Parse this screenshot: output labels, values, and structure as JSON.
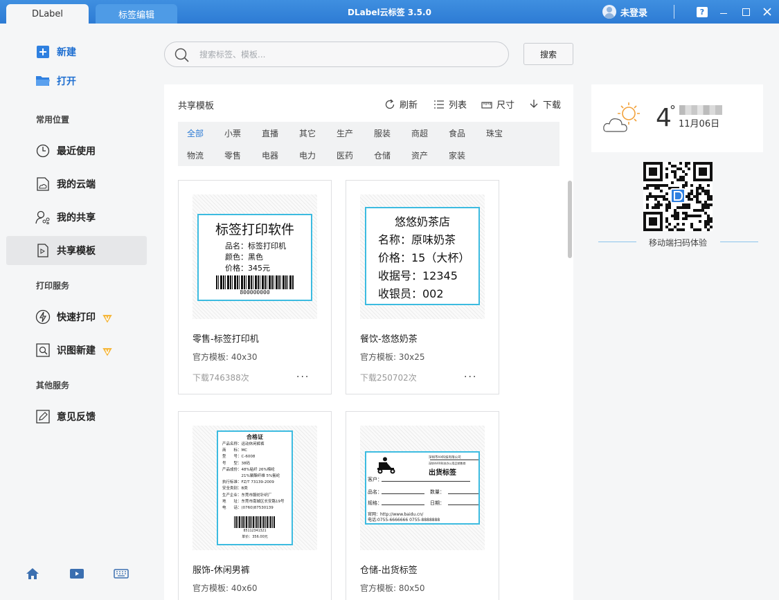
{
  "titlebar": {
    "tabs": [
      "DLabel",
      "标签编辑"
    ],
    "title": "DLabel云标签 3.5.0",
    "user_label": "未登录",
    "help": "?"
  },
  "sidebar": {
    "primary": [
      {
        "label": "新建",
        "icon": "plus-icon"
      },
      {
        "label": "打开",
        "icon": "folder-icon"
      }
    ],
    "sections": [
      {
        "heading": "常用位置",
        "items": [
          {
            "label": "最近使用",
            "icon": "clock-icon"
          },
          {
            "label": "我的云端",
            "icon": "cloud-doc-icon"
          },
          {
            "label": "我的共享",
            "icon": "share-icon"
          },
          {
            "label": "共享模板",
            "icon": "template-icon",
            "active": true
          }
        ]
      },
      {
        "heading": "打印服务",
        "items": [
          {
            "label": "快速打印",
            "icon": "lightning-icon",
            "vip": true
          },
          {
            "label": "识图新建",
            "icon": "scan-icon",
            "vip": true
          }
        ]
      },
      {
        "heading": "其他服务",
        "items": [
          {
            "label": "意见反馈",
            "icon": "edit-icon"
          }
        ]
      }
    ],
    "vip_badge": "V",
    "bottom_icons": [
      "home-icon",
      "video-icon",
      "keyboard-icon"
    ]
  },
  "search": {
    "placeholder": "搜索标签、模板...",
    "value": "",
    "button": "搜索"
  },
  "panel": {
    "title": "共享模板",
    "tools": [
      {
        "label": "刷新",
        "icon": "refresh-icon"
      },
      {
        "label": "列表",
        "icon": "list-icon"
      },
      {
        "label": "尺寸",
        "icon": "ruler-icon"
      },
      {
        "label": "下载",
        "icon": "download-icon"
      }
    ],
    "categories_row1": [
      "全部",
      "小票",
      "直播",
      "其它",
      "生产",
      "服装",
      "商超",
      "食品",
      "珠宝"
    ],
    "categories_row2": [
      "物流",
      "零售",
      "电器",
      "电力",
      "医药",
      "仓储",
      "资产",
      "家装"
    ],
    "active_category": "全部"
  },
  "cards": [
    {
      "title": "零售-标签打印机",
      "size": "官方模板: 40x30",
      "downloads": "下载746388次",
      "more": "...",
      "label": {
        "heading": "标签打印软件",
        "lines": [
          "品名：标签打印机",
          "颜色：黑色",
          "价格：345元"
        ],
        "barcode": "800000000"
      }
    },
    {
      "title": "餐饮-悠悠奶茶",
      "size": "官方模板: 30x25",
      "downloads": "下载250702次",
      "more": "...",
      "label": {
        "heading": "悠悠奶茶店",
        "lines": [
          "名称：原味奶茶",
          "价格：15（大杯）",
          "收据号：12345",
          "收银员：002"
        ]
      }
    },
    {
      "title": "服饰-休闲男裤",
      "size": "官方模板: 40x60",
      "label": {
        "heading": "合格证",
        "lines": [
          "产品名称：运动休闲裤裤",
          "商　　标：MC",
          "型　　号：C-6008",
          "号　　型：38码",
          "产品成份：48%粘纤 26%棉纶",
          "　　　　　21%聚酯纤维 5%氨纶",
          "执行标准：FZ/T 73139-2009",
          "安全类别：B类",
          "生产企业：东莞市服纺针织厂",
          "地　　址：东莞市南城区长安路19号",
          "电　　话：(0760)87530139"
        ],
        "barcode": "85112341321",
        "price": "单价：356.00元"
      }
    },
    {
      "title": "仓储-出货标签",
      "size": "官方模板: 80x50",
      "label": {
        "company1": "深圳市XX科技有限公司",
        "company2": "深圳市XX科技办公用品销售商",
        "heading": "出货标签",
        "fields": [
          "客户：",
          "品名：",
          "数量：",
          "规格：",
          "日期："
        ],
        "site": "官网：http://www.baidu.cn/",
        "phone": "电话:0755-6666666   0755-8888888"
      }
    }
  ],
  "weather": {
    "temperature": "4",
    "degree": "°",
    "date": "11月06日",
    "icon": "sun-cloud-icon"
  },
  "qr": {
    "caption": "移动端扫码体验"
  }
}
